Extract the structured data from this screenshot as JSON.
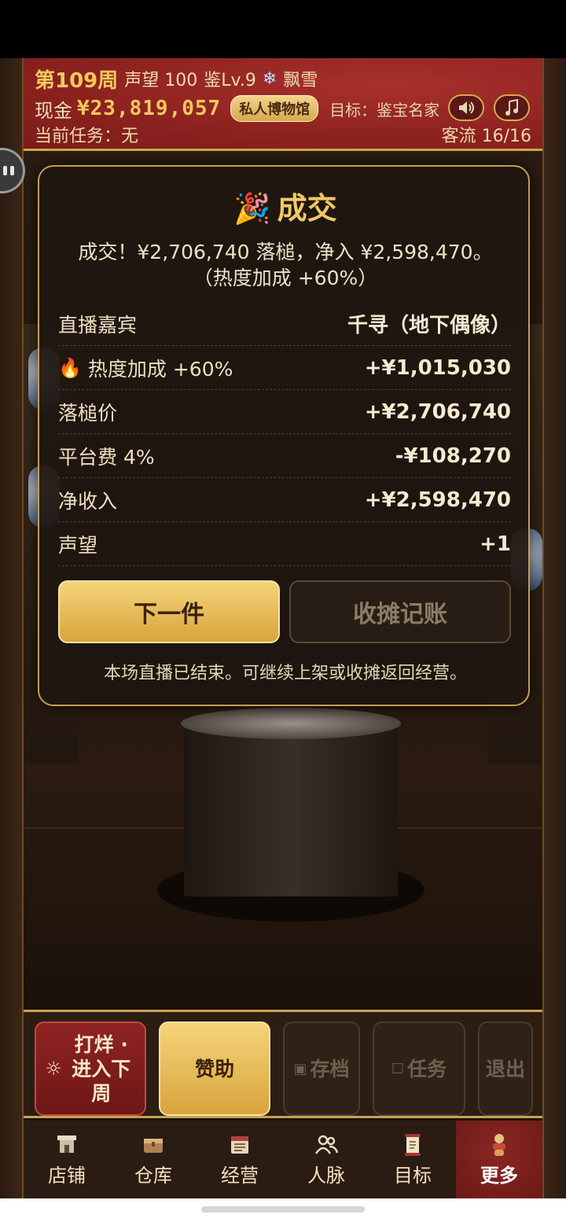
{
  "header": {
    "week": "第109周",
    "reputation": "声望 100",
    "appraisal_level": "鉴Lv.9",
    "weather_icon": "snowflake-icon",
    "weather": "飘雪",
    "cash_label": "现金",
    "cash_value": "¥23,819,057",
    "badge": "私人博物馆",
    "goal": "目标：鉴宝名家",
    "task": "当前任务：无",
    "visitors": "客流 16/16",
    "sound_icon": "speaker-icon",
    "music_icon": "music-note-icon"
  },
  "modal": {
    "title_icon": "party-popper-icon",
    "title": "成交",
    "message_line1": "成交！¥2,706,740 落槌，净入 ¥2,598,470。",
    "message_line2": "（热度加成 +60%）",
    "rows": [
      {
        "label": "直播嘉宾",
        "value": "千寻（地下偶像）"
      },
      {
        "label": "热度加成 +60%",
        "value": "+¥1,015,030",
        "icon": "fire-icon"
      },
      {
        "label": "落槌价",
        "value": "+¥2,706,740"
      },
      {
        "label": "平台费 4%",
        "value": "-¥108,270"
      },
      {
        "label": "净收入",
        "value": "+¥2,598,470"
      },
      {
        "label": "声望",
        "value": "+1"
      }
    ],
    "next_button": "下一件",
    "close_button": "收摊记账",
    "note": "本场直播已结束。可继续上架或收摊返回经营。"
  },
  "actions": {
    "close_shop": "打烊 · 进入下周",
    "sponsor": "赞助",
    "save": "存档",
    "tasks": "任务",
    "exit": "退出"
  },
  "nav": [
    {
      "label": "店铺",
      "icon": "shop-icon"
    },
    {
      "label": "仓库",
      "icon": "warehouse-icon"
    },
    {
      "label": "经营",
      "icon": "ledger-icon"
    },
    {
      "label": "人脉",
      "icon": "contacts-icon"
    },
    {
      "label": "目标",
      "icon": "scroll-icon"
    },
    {
      "label": "更多",
      "icon": "more-icon",
      "active": true
    }
  ],
  "colors": {
    "header_red": "#8e2320",
    "gold": "#f0c865",
    "panel_border": "#c49b54"
  }
}
